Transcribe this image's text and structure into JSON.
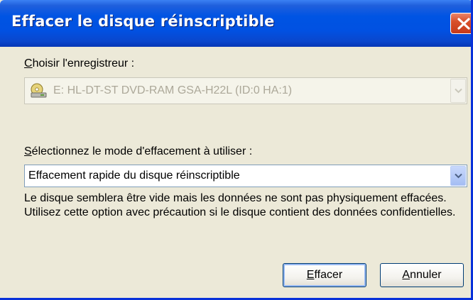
{
  "window": {
    "title": "Effacer le disque réinscriptible"
  },
  "recorder": {
    "label_accel": "C",
    "label_rest": "hoisir l'enregistreur :",
    "selected": "E: HL-DT-ST DVD-RAM GSA-H22L (ID:0 HA:1)",
    "enabled": false,
    "icon": "disc-drive-icon"
  },
  "erase_mode": {
    "label_accel": "S",
    "label_rest": "électionnez le mode d'effacement à utiliser :",
    "selected": "Effacement rapide du disque réinscriptible",
    "description": "Le disque semblera être vide mais les données ne sont pas physiquement effacées. Utilisez cette option avec précaution si le disque contient des données confidentielles."
  },
  "buttons": {
    "erase_accel": "E",
    "erase_rest": "ffacer",
    "cancel_accel": "A",
    "cancel_rest": "nnuler"
  },
  "colors": {
    "titlebar": "#0054e3",
    "dialog_bg": "#ece9d8",
    "close_button": "#d8502c",
    "field_border": "#7f9db9",
    "disabled_text": "#aca899"
  }
}
